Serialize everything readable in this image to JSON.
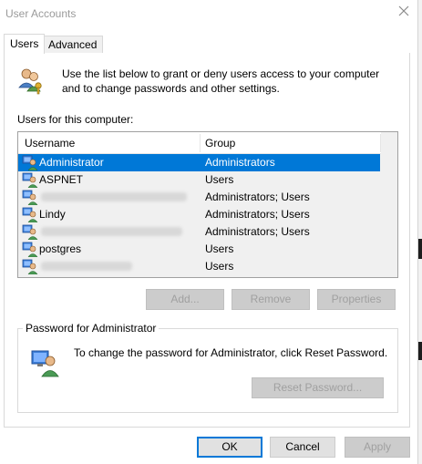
{
  "window": {
    "title": "User Accounts",
    "close_icon": "close-icon"
  },
  "tabs": [
    {
      "label": "Users",
      "active": true
    },
    {
      "label": "Advanced",
      "active": false
    }
  ],
  "intro": {
    "text": "Use the list below to grant or deny users access to your computer and to change passwords and other settings."
  },
  "users_section": {
    "label": "Users for this computer:"
  },
  "table": {
    "columns": [
      "Username",
      "Group"
    ],
    "rows": [
      {
        "username": "Administrator",
        "group": "Administrators",
        "selected": true,
        "obscured": false
      },
      {
        "username": "ASPNET",
        "group": "Users",
        "selected": false,
        "obscured": false
      },
      {
        "username": "",
        "group": "Administrators; Users",
        "selected": false,
        "obscured": true
      },
      {
        "username": "Lindy",
        "group": "Administrators; Users",
        "selected": false,
        "obscured": false
      },
      {
        "username": "",
        "group": "Administrators; Users",
        "selected": false,
        "obscured": true
      },
      {
        "username": "postgres",
        "group": "Users",
        "selected": false,
        "obscured": false
      },
      {
        "username": "",
        "group": "Users",
        "selected": false,
        "obscured": true
      }
    ]
  },
  "list_buttons": {
    "add": "Add...",
    "remove": "Remove",
    "properties": "Properties"
  },
  "password_group": {
    "label": "Password for Administrator",
    "text": "To change the password for Administrator, click Reset Password.",
    "reset_button": "Reset Password..."
  },
  "dialog_buttons": {
    "ok": "OK",
    "cancel": "Cancel",
    "apply": "Apply"
  },
  "colors": {
    "selection": "#0078d7",
    "disabled_text": "#a0a0a0",
    "button_face": "#e1e1e1"
  }
}
